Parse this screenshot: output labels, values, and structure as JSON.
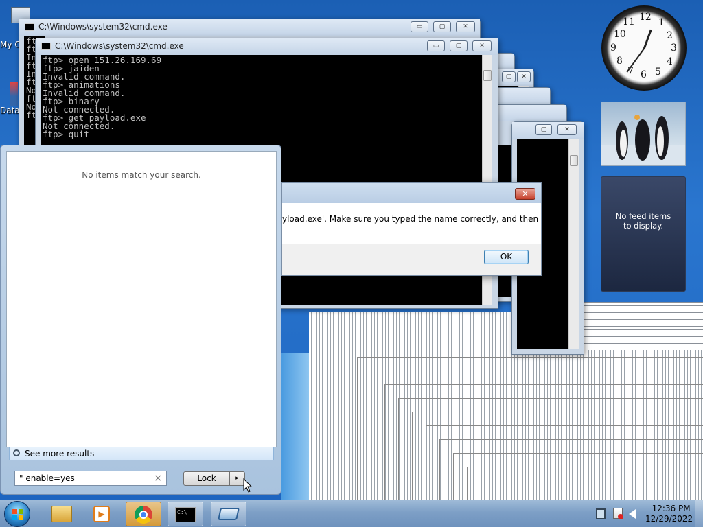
{
  "desktop": {
    "icons": [
      {
        "label": "My C"
      },
      {
        "label": "Data"
      }
    ]
  },
  "cmd_windows": [
    {
      "title": "C:\\Windows\\system32\\cmd.exe"
    },
    {
      "title": "C:\\Windows\\system32\\cmd.exe"
    }
  ],
  "back_console_lines": "ftp\nft\nIn\nft\nIn\nft\nNo\nft\nNo\nft",
  "console_lines": "ftp> open 151.26.169.69\nftp> jaiden\nInvalid command.\nftp> animations\nInvalid command.\nftp> binary\nNot connected.\nftp> get payload.exe\nNot connected.\nftp> quit",
  "window_controls": {
    "minimize": "▭",
    "maximize": "▢",
    "close": "✕"
  },
  "dialog": {
    "message": "yload.exe'. Make sure you typed the name correctly, and then try",
    "ok_label": "OK",
    "close_label": "✕"
  },
  "start_menu": {
    "no_results": "No items match your search.",
    "see_more": "See more results",
    "search_value": "\" enable=yes",
    "clear_label": "×",
    "lock_label": "Lock",
    "arrow_label": "▸"
  },
  "gadgets": {
    "clock_numbers": [
      "12",
      "1",
      "2",
      "3",
      "4",
      "5",
      "6",
      "7",
      "8",
      "9",
      "10",
      "11"
    ],
    "feed_text": "No feed items to display."
  },
  "taskbar": {
    "items": [
      "windows-explorer",
      "media-player",
      "chrome",
      "cmd",
      "remote-desktop"
    ],
    "cmd_icon_text": "C:\\_",
    "time": "12:36 PM",
    "date": "12/29/2022"
  }
}
